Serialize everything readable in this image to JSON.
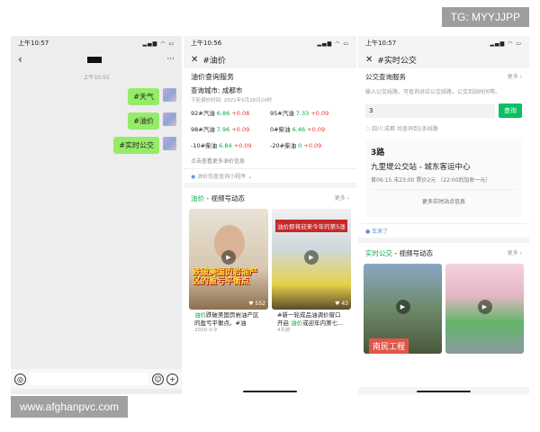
{
  "watermark_top": "TG: MYYJJPP",
  "watermark_bottom": "www.afghanpvc.com",
  "chat": {
    "time_status": "上午10:57",
    "more": "···",
    "time_divider": "上午10:55",
    "messages": [
      "#天气",
      "#油价",
      "#实时公交"
    ]
  },
  "oil": {
    "time_status": "上午10:56",
    "title": "#油价",
    "service": "油价查询服务",
    "city": "查询城市: 成都市",
    "update": "下轮调价时间: 2021年5月28日24时",
    "items": [
      {
        "name": "92#汽油",
        "price": "6.86",
        "change": "+0.08"
      },
      {
        "name": "95#汽油",
        "price": "7.33",
        "change": "+0.09"
      },
      {
        "name": "98#汽油",
        "price": "7.96",
        "change": "+0.09"
      },
      {
        "name": "0#柴油",
        "price": "6.46",
        "change": "+0.09"
      },
      {
        "name": "-10#柴油",
        "price": "6.84",
        "change": "+0.09"
      },
      {
        "name": "-20#柴油",
        "price": "0",
        "change": "+0.09"
      }
    ],
    "more_link": "点击查看更多油价信息",
    "source": "油价信息查询小程序 ⌄",
    "video_kw": "油价",
    "video_title": " - 视频号动态",
    "video_more": "更多 ›",
    "thumb1_overlay": "跌破美国页岩油产区的盈亏平衡点",
    "thumb1_count": "552",
    "thumb2_banner": "油价即将迎来今年的第5涨",
    "thumb2_count": "43",
    "cap1_kw": "油价",
    "cap1_text": "跌破美国页岩油产区的盈亏平衡点。#油",
    "cap1_date": "2020-3-9",
    "cap2_text": "#新一轮成品油调价窗口开启 ",
    "cap2_kw": "油价",
    "cap2_text2": "或迎年内第七...",
    "cap2_date": "4天前"
  },
  "bus": {
    "time_status": "上午10:57",
    "title": "#实时公交",
    "service": "公交查询服务",
    "service_more": "更多 ›",
    "intro": "输入公交线路，可查询对应公交线路，公交到站时间等。",
    "input_value": "3",
    "search_btn": "查询",
    "location": "四川 成都 共查询到1条线路",
    "route_no": "3路",
    "route_path": "九里堤公交站 - 城东客运中心",
    "route_time": "首06:15 末23:00 票价2元 （22:00后加收一元）",
    "more_info": "更多实时站点信息",
    "source": "车来了",
    "video_kw": "实时公交",
    "video_title": " - 视频号动态",
    "video_more": "更多 ›",
    "thumb1_text": "南民工程"
  }
}
